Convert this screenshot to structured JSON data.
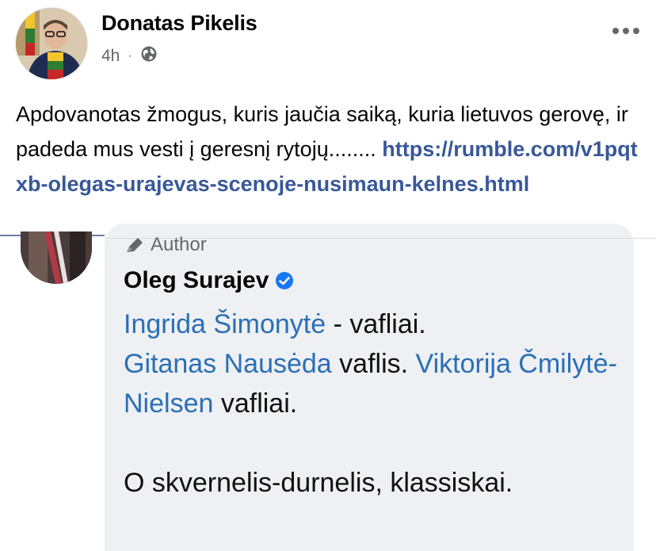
{
  "post": {
    "author": "Donatas Pikelis",
    "time": "4h",
    "separator": "·",
    "privacy_icon": "globe-icon",
    "more_icon": "more-horizontal-icon",
    "text": "Apdovanotas žmogus, kuris jaučia saiką, kuria lietuvos gerovę, ir padeda mus vesti į geresnį rytojų........",
    "link": "https://rumble.com/v1pqtxb-olegas-urajevas-scenoje-nusimaun-kelnes.html"
  },
  "shared_image": {
    "author_tag": "Author",
    "commenter": "Oleg Surajev",
    "verified_icon": "verified-badge-icon",
    "comment": {
      "mention1": "Ingrida Šimonytė",
      "text1": " - vafliai.",
      "mention2": "Gitanas Nausėda",
      "text2": " vaflis. ",
      "mention3": "Viktorija Čmilytė-Nielsen",
      "text3": " vafliai.",
      "paragraph2": "O skvernelis-durnelis, klassiskai."
    }
  },
  "colors": {
    "link": "#385898",
    "mention": "#2a6fb6",
    "bubble": "#eef0f3",
    "meta": "#65676b"
  }
}
